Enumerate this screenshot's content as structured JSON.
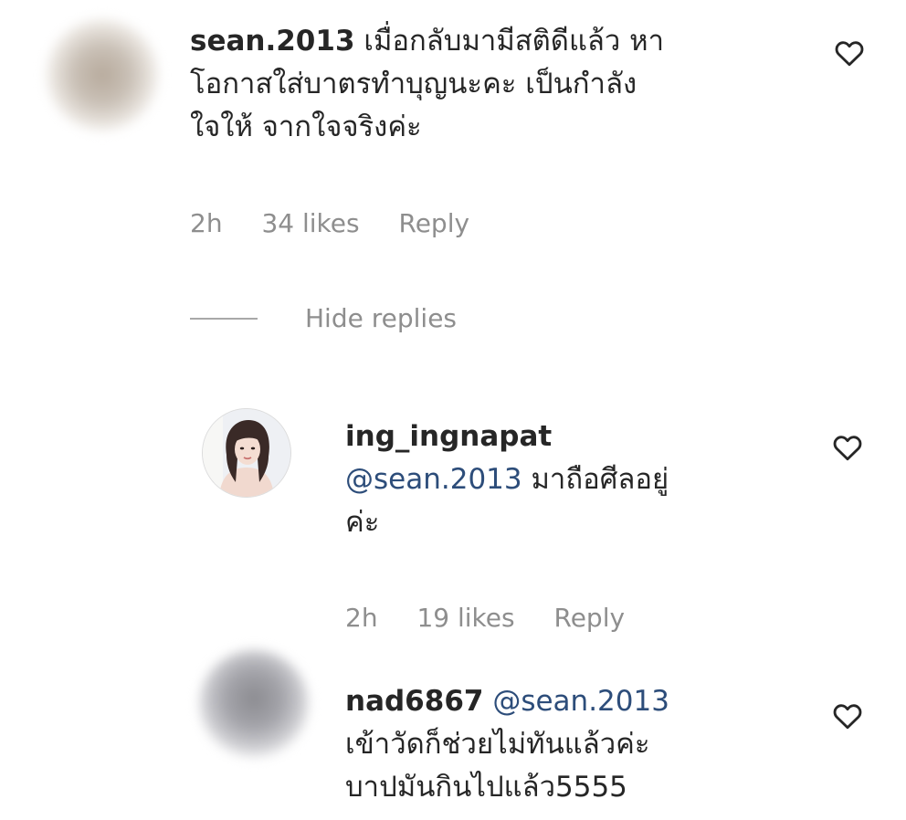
{
  "comments": [
    {
      "username": "sean.2013",
      "mention": "",
      "lines": [
        "เมื่อกลับมามีสติดีแล้ว หา",
        "โอกาสใส่บาตรทำบุญนะคะ เป็นกำลัง",
        "ใจให้ จากใจจริงค่ะ"
      ],
      "time": "2h",
      "likes": "34 likes",
      "reply_label": "Reply"
    },
    {
      "username": "ing_ingnapat",
      "mention": "@sean.2013",
      "lines": [
        "มาถือศีลอยู่",
        "ค่ะ"
      ],
      "time": "2h",
      "likes": "19 likes",
      "reply_label": "Reply"
    },
    {
      "username": "nad6867",
      "mention": "@sean.2013",
      "lines": [
        "เข้าวัดก็ช่วยไม่ทันแล้วค่ะ",
        "บาปมันกินไปแล้ว5555"
      ]
    }
  ],
  "hide_replies_label": "Hide replies",
  "icons": {
    "like": "heart-icon"
  },
  "colors": {
    "text": "#262626",
    "muted": "#8e8e8e",
    "mention": "#2d4d7a"
  }
}
